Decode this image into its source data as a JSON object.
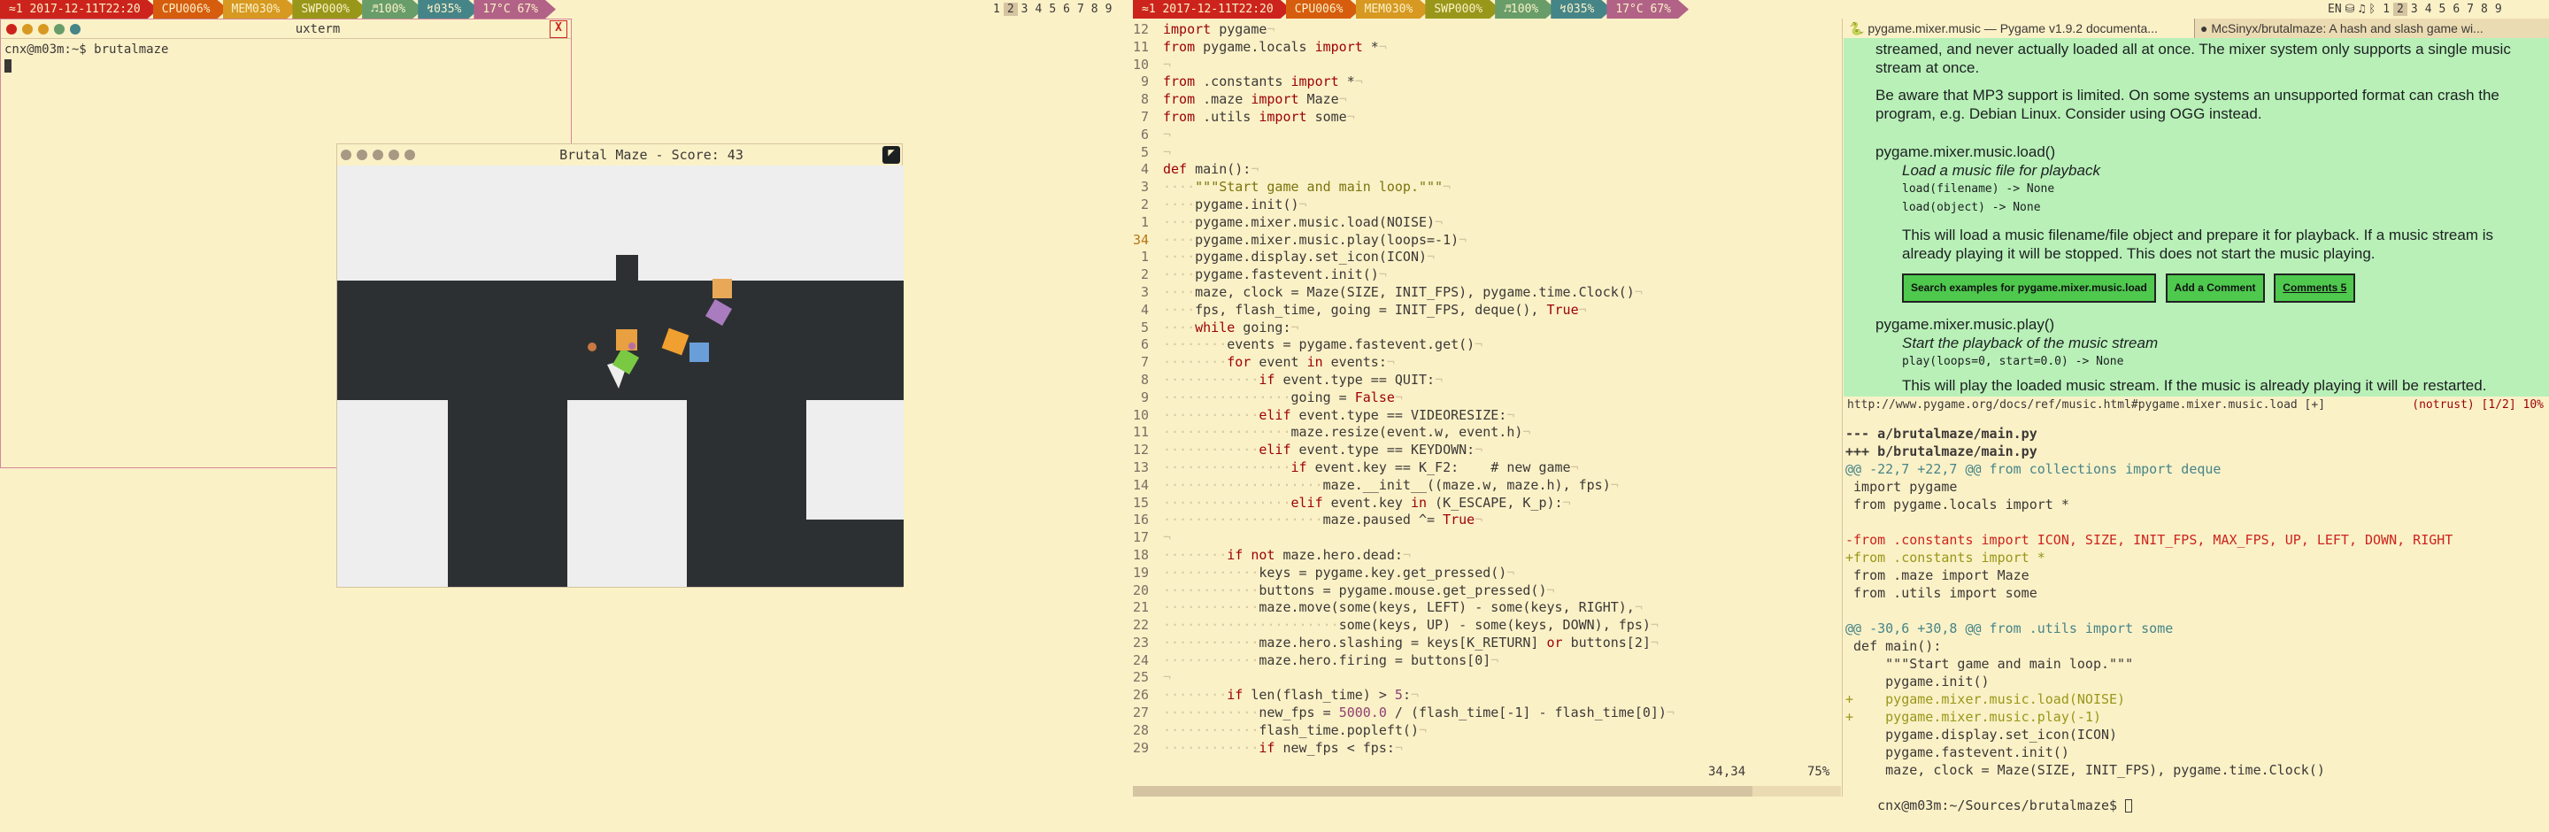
{
  "statusbar_left": {
    "segments": [
      "≈1 2017-12-11T22:20",
      "CPU006%",
      "MEM030%",
      "SWP000%",
      "♬100%",
      "↯035%",
      "17°C 67%"
    ]
  },
  "statusbar_right": {
    "segments": [
      "≈1 2017-12-11T22:20",
      "CPU006%",
      "MEM030%",
      "SWP000%",
      "♬100%",
      "↯035%",
      "17°C 67%"
    ],
    "lang": "EN"
  },
  "workspaces_left": [
    "1",
    "2",
    "3",
    "4",
    "5",
    "6",
    "7",
    "8",
    "9"
  ],
  "workspaces_right": [
    "1",
    "2",
    "3",
    "4",
    "5",
    "6",
    "7",
    "8",
    "9"
  ],
  "uxterm": {
    "title": "uxterm",
    "prompt": "cnx@m03m:~$ brutalmaze"
  },
  "game": {
    "title": "Brutal Maze - Score: 43"
  },
  "editor": {
    "lines": [
      {
        "n": "12",
        "t": "import pygame"
      },
      {
        "n": "11",
        "t": "from pygame.locals import *"
      },
      {
        "n": "10",
        "t": ""
      },
      {
        "n": "9",
        "t": "from .constants import *"
      },
      {
        "n": "8",
        "t": "from .maze import Maze"
      },
      {
        "n": "7",
        "t": "from .utils import some"
      },
      {
        "n": "6",
        "t": ""
      },
      {
        "n": "5",
        "t": ""
      },
      {
        "n": "4",
        "t": "def main():"
      },
      {
        "n": "3",
        "t": "    \"\"\"Start game and main loop.\"\"\""
      },
      {
        "n": "2",
        "t": "    pygame.init()"
      },
      {
        "n": "1",
        "t": "    pygame.mixer.music.load(NOISE)"
      },
      {
        "n": "34",
        "t": "    pygame.mixer.music.play(loops=-1)"
      },
      {
        "n": "1",
        "t": "    pygame.display.set_icon(ICON)"
      },
      {
        "n": "2",
        "t": "    pygame.fastevent.init()"
      },
      {
        "n": "3",
        "t": "    maze, clock = Maze(SIZE, INIT_FPS), pygame.time.Clock()"
      },
      {
        "n": "4",
        "t": "    fps, flash_time, going = INIT_FPS, deque(), True"
      },
      {
        "n": "5",
        "t": "    while going:"
      },
      {
        "n": "6",
        "t": "        events = pygame.fastevent.get()"
      },
      {
        "n": "7",
        "t": "        for event in events:"
      },
      {
        "n": "8",
        "t": "            if event.type == QUIT:"
      },
      {
        "n": "9",
        "t": "                going = False"
      },
      {
        "n": "10",
        "t": "            elif event.type == VIDEORESIZE:"
      },
      {
        "n": "11",
        "t": "                maze.resize(event.w, event.h)"
      },
      {
        "n": "12",
        "t": "            elif event.type == KEYDOWN:"
      },
      {
        "n": "13",
        "t": "                if event.key == K_F2:    # new game"
      },
      {
        "n": "14",
        "t": "                    maze.__init__((maze.w, maze.h), fps)"
      },
      {
        "n": "15",
        "t": "                elif event.key in (K_ESCAPE, K_p):"
      },
      {
        "n": "16",
        "t": "                    maze.paused ^= True"
      },
      {
        "n": "17",
        "t": ""
      },
      {
        "n": "18",
        "t": "        if not maze.hero.dead:"
      },
      {
        "n": "19",
        "t": "            keys = pygame.key.get_pressed()"
      },
      {
        "n": "20",
        "t": "            buttons = pygame.mouse.get_pressed()"
      },
      {
        "n": "21",
        "t": "            maze.move(some(keys, LEFT) - some(keys, RIGHT),"
      },
      {
        "n": "22",
        "t": "                      some(keys, UP) - some(keys, DOWN), fps)"
      },
      {
        "n": "23",
        "t": "            maze.hero.slashing = keys[K_RETURN] or buttons[2]"
      },
      {
        "n": "24",
        "t": "            maze.hero.firing = buttons[0]"
      },
      {
        "n": "25",
        "t": ""
      },
      {
        "n": "26",
        "t": "        if len(flash_time) > 5:"
      },
      {
        "n": "27",
        "t": "            new_fps = 5000.0 / (flash_time[-1] - flash_time[0])"
      },
      {
        "n": "28",
        "t": "            flash_time.popleft()"
      },
      {
        "n": "29",
        "t": "            if new_fps < fps:"
      }
    ],
    "cursor_pos": "34,34",
    "percent": "75%"
  },
  "browser": {
    "tabs": [
      "pygame.mixer.music — Pygame v1.9.2 documenta...",
      "McSinyx/brutalmaze: A hash and slash game wi..."
    ],
    "p1": "streamed, and never actually loaded all at once. The mixer system only supports a single music stream at once.",
    "p2": "Be aware that MP3 support is limited. On some systems an unsupported format can crash the program, e.g. Debian Linux. Consider using OGG instead.",
    "f1_name": "pygame.mixer.music.load()",
    "f1_desc": "Load a music file for playback",
    "f1_sig1": "load(filename) -> None",
    "f1_sig2": "load(object) -> None",
    "f1_body": "This will load a music filename/file object and prepare it for playback. If a music stream is already playing it will be stopped. This does not start the music playing.",
    "btn_search": "Search examples for pygame.mixer.music.load",
    "btn_comment": "Add a Comment",
    "btn_comments": "Comments 5",
    "f2_name": "pygame.mixer.music.play()",
    "f2_desc": "Start the playback of the music stream",
    "f2_sig": "play(loops=0, start=0.0) -> None",
    "f2_body": "This will play the loaded music stream. If the music is already playing it will be restarted.",
    "url": "http://www.pygame.org/docs/ref/music.html#pygame.mixer.music.load [+]",
    "url_status": "(notrust) [1/2] 10%"
  },
  "diff": {
    "lines": [
      {
        "k": "h",
        "t": "--- a/brutalmaze/main.py"
      },
      {
        "k": "h",
        "t": "+++ b/brutalmaze/main.py"
      },
      {
        "k": "at",
        "t": "@@ -22,7 +22,7 @@ from collections import deque"
      },
      {
        "k": "c",
        "t": " import pygame"
      },
      {
        "k": "c",
        "t": " from pygame.locals import *"
      },
      {
        "k": "c",
        "t": ""
      },
      {
        "k": "m",
        "t": "-from .constants import ICON, SIZE, INIT_FPS, MAX_FPS, UP, LEFT, DOWN, RIGHT"
      },
      {
        "k": "p",
        "t": "+from .constants import *"
      },
      {
        "k": "c",
        "t": " from .maze import Maze"
      },
      {
        "k": "c",
        "t": " from .utils import some"
      },
      {
        "k": "c",
        "t": ""
      },
      {
        "k": "at",
        "t": "@@ -30,6 +30,8 @@ from .utils import some"
      },
      {
        "k": "c",
        "t": " def main():"
      },
      {
        "k": "c",
        "t": "     \"\"\"Start game and main loop.\"\"\""
      },
      {
        "k": "c",
        "t": "     pygame.init()"
      },
      {
        "k": "p",
        "t": "+    pygame.mixer.music.load(NOISE)"
      },
      {
        "k": "p",
        "t": "+    pygame.mixer.music.play(-1)"
      },
      {
        "k": "c",
        "t": "     pygame.display.set_icon(ICON)"
      },
      {
        "k": "c",
        "t": "     pygame.fastevent.init()"
      },
      {
        "k": "c",
        "t": "     maze, clock = Maze(SIZE, INIT_FPS), pygame.time.Clock()"
      }
    ],
    "prompt": "cnx@m03m:~/Sources/brutalmaze$ "
  },
  "colors": {
    "bg": "#fbf1c7",
    "doc_bg": "#b8f0b8",
    "maze_dark": "#2d3033",
    "maze_light": "#eeeeee"
  }
}
